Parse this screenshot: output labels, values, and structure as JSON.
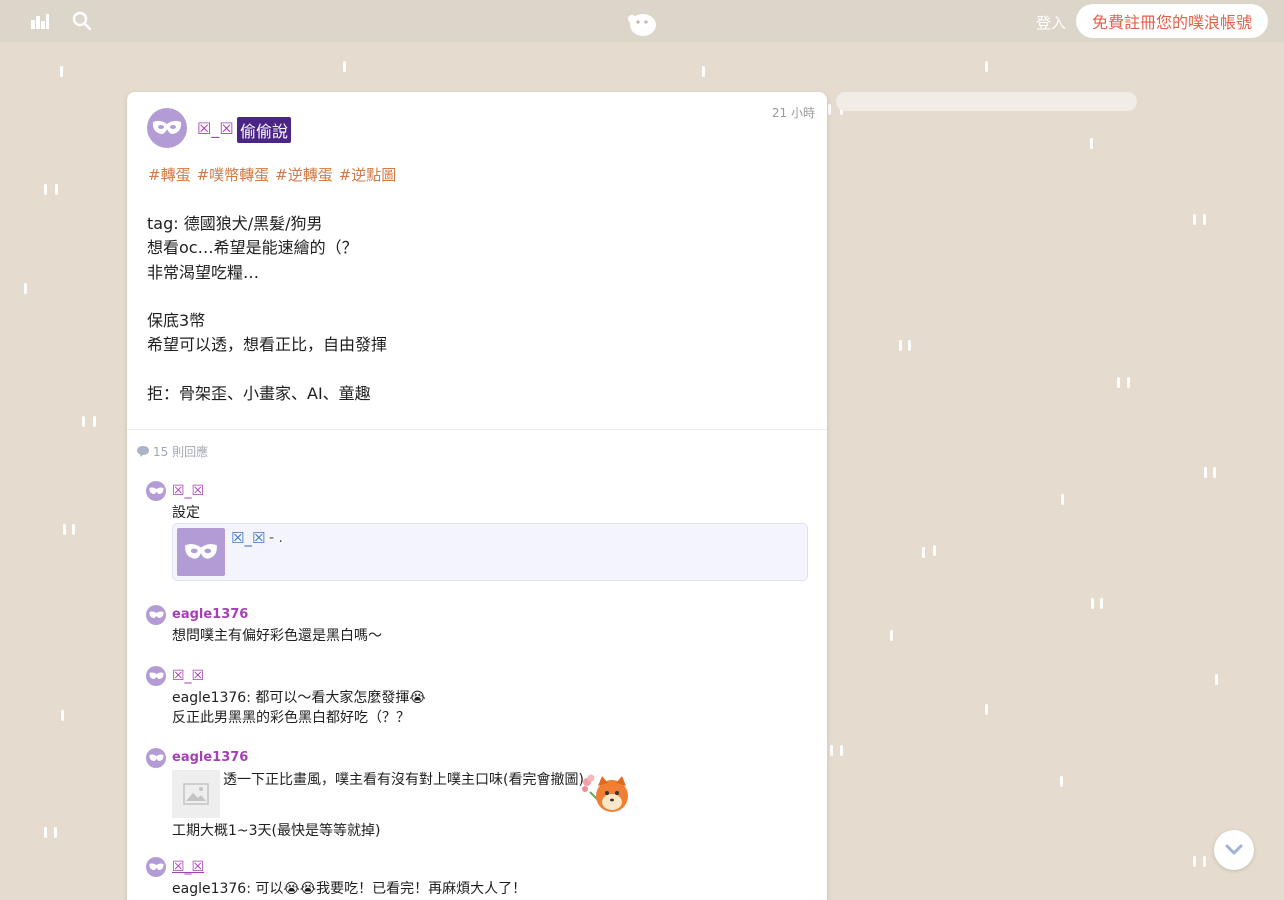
{
  "topbar": {
    "login_label": "登入",
    "signup_label": "免費註冊您的噗浪帳號",
    "accent_color": "#e4624a"
  },
  "post": {
    "author": "☒_☒",
    "anon_badge": "偷偷說",
    "time": "21 小時",
    "hashtags": [
      "#轉蛋",
      "#噗幣轉蛋",
      "#逆轉蛋",
      "#逆點圖"
    ],
    "lines": [
      "tag: 德國狼犬/黑髮/狗男",
      "想看oc…希望是能速繪的（？",
      "非常渴望吃糧…",
      "",
      "保底3幣",
      "希望可以透，想看正比，自由發揮",
      "",
      "拒：骨架歪、小畫家、AI、童趣"
    ],
    "reply_count": "15 則回應"
  },
  "responses": [
    {
      "name": "☒_☒",
      "text": "設定",
      "quote": {
        "name": "☒_☒",
        "suffix": "- ."
      }
    },
    {
      "name": "eagle1376",
      "text": "想問噗主有偏好彩色還是黑白嗎～"
    },
    {
      "name": "☒_☒",
      "line1": "eagle1376: 都可以～看大家怎麼發揮😭",
      "line2": "反正此男黑黑的彩色黑白都好吃（？？"
    },
    {
      "name": "eagle1376",
      "line1": "透一下正比畫風，噗主看有沒有對上噗主口味(看完會撤圖)",
      "line2": "工期大概1~3天(最快是等等就掉)"
    },
    {
      "name": "☒_☒",
      "line1": "eagle1376: 可以😭😭我要吃！已看完！再麻煩大人了！"
    }
  ]
}
